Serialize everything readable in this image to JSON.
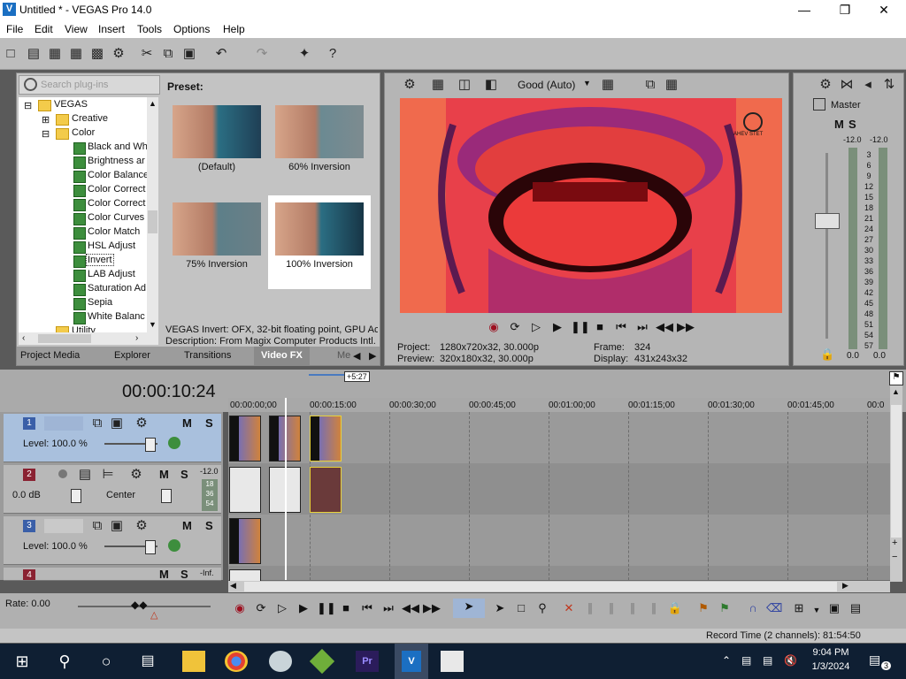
{
  "window": {
    "title": "Untitled * - VEGAS Pro 14.0",
    "logo": "V"
  },
  "menu": [
    "File",
    "Edit",
    "View",
    "Insert",
    "Tools",
    "Options",
    "Help"
  ],
  "plugins": {
    "search_placeholder": "Search plug-ins",
    "tree": {
      "root": "VEGAS",
      "creative": "Creative",
      "color": "Color",
      "items": [
        "Black and Wh",
        "Brightness ar",
        "Color Balance",
        "Color Correct",
        "Color Correct",
        "Color Curves",
        "Color Match",
        "HSL Adjust",
        "Invert",
        "LAB Adjust",
        "Saturation Ad",
        "Sepia",
        "White Balanc"
      ],
      "utility": "Utility"
    },
    "preset_label": "Preset:",
    "presets": [
      "(Default)",
      "60% Inversion",
      "75% Inversion",
      "100% Inversion"
    ],
    "selected_preset": "100% Inversion",
    "info_line1": "VEGAS Invert: OFX, 32-bit floating point, GPU Ac",
    "info_line2": "Description: From Magix Computer Products Intl.",
    "tabs": [
      "Project Media",
      "Explorer",
      "Transitions",
      "Video FX",
      "Me"
    ],
    "active_tab": "Video FX"
  },
  "preview": {
    "quality": "Good (Auto)",
    "project_label": "Project:",
    "project_value": "1280x720x32, 30.000p",
    "preview_label": "Preview:",
    "preview_value": "320x180x32, 30.000p",
    "frame_label": "Frame:",
    "frame_value": "324",
    "display_label": "Display:",
    "display_value": "431x243x32",
    "watermark": "AHEV STET"
  },
  "master": {
    "label": "Master",
    "left_db": "-12.0",
    "right_db": "-12.0",
    "scale": [
      "3",
      "6",
      "9",
      "12",
      "15",
      "18",
      "21",
      "24",
      "27",
      "30",
      "33",
      "36",
      "39",
      "42",
      "45",
      "48",
      "51",
      "54",
      "57"
    ],
    "bottom_left": "0.0",
    "bottom_right": "0.0"
  },
  "timeline": {
    "timecode": "00:00:10:24",
    "duration_badge": "+5:27",
    "ruler": [
      "00:00:00;00",
      "00:00:15:00",
      "00:00:30;00",
      "00:00:45;00",
      "00:01:00;00",
      "00:01:15;00",
      "00:01:30;00",
      "00:01:45;00",
      "00:0"
    ],
    "tracks": [
      {
        "num": "1",
        "level": "Level: 100.0 %"
      },
      {
        "num": "2",
        "level": "0.0 dB",
        "pan": "Center",
        "meter_top": "-12.0",
        "meter": [
          "18",
          "36",
          "54"
        ]
      },
      {
        "num": "3",
        "level": "Level: 100.0 %"
      },
      {
        "num": "4",
        "meter_top": "-Inf."
      }
    ],
    "mute": "M",
    "solo": "S",
    "rate": "Rate: 0.00",
    "record_time": "Record Time (2 channels): 81:54:50"
  },
  "taskbar": {
    "time": "9:04 PM",
    "date": "1/3/2024",
    "notifications": "3"
  },
  "colors": {
    "accent": "#1b6fc2",
    "video_bg": "#f26a4b",
    "selected_event": "#e8d23a"
  }
}
